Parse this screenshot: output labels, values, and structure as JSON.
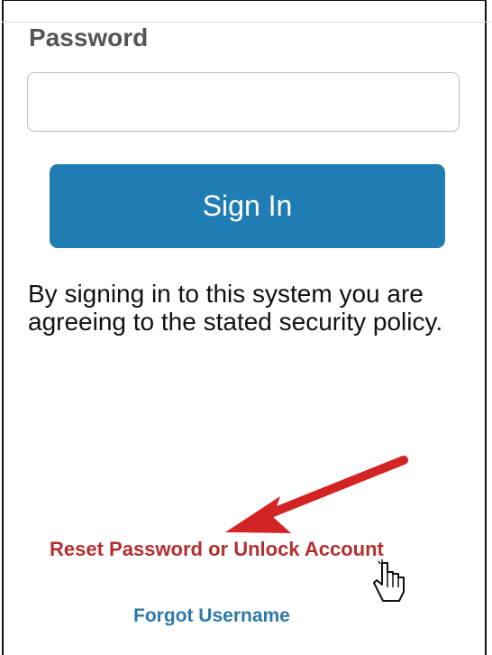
{
  "login_form": {
    "password_label": "Password",
    "password_value": "",
    "sign_in_label": "Sign In",
    "policy_text": "By signing in to this system you are agreeing to the stated security policy.",
    "reset_link": "Reset Password or Unlock Account",
    "forgot_username_link": "Forgot Username"
  },
  "colors": {
    "primary_button": "#1f7db3",
    "reset_link": "#b42e2e",
    "forgot_link": "#2d78a8",
    "annotation_arrow": "#d22424"
  },
  "icons": {
    "annotation": "red-arrow-icon",
    "cursor": "hand-pointer-icon"
  }
}
